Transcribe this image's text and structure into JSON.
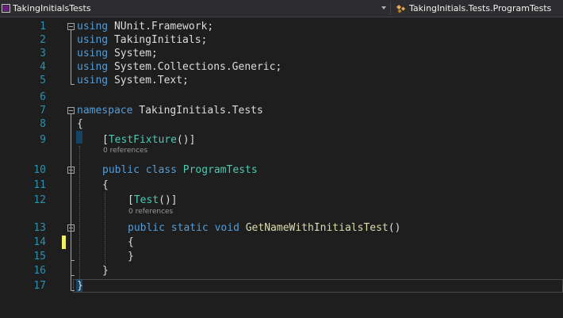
{
  "navbar": {
    "project": "TakingInitialsTests",
    "member": "TakingInitials.Tests.ProgramTests"
  },
  "editor": {
    "line_numbers": [
      "1",
      "2",
      "3",
      "4",
      "5",
      "6",
      "7",
      "8",
      "9",
      "10",
      "11",
      "12",
      "13",
      "14",
      "15",
      "16",
      "17"
    ],
    "code": {
      "l1_kw": "using",
      "l1_ns": " NUnit.Framework;",
      "l2_kw": "using",
      "l2_ns": " TakingInitials;",
      "l3_kw": "using",
      "l3_ns": " System;",
      "l4_kw": "using",
      "l4_ns": " System.Collections.Generic;",
      "l5_kw": "using",
      "l5_ns": " System.Text;",
      "l7_kw": "namespace",
      "l7_ns": " TakingInitials.Tests",
      "l8": "{",
      "l9_open": "[",
      "l9_attr": "TestFixture",
      "l9_close": "()]",
      "l10_kw1": "public",
      "l10_kw2": "class",
      "l10_type": "ProgramTests",
      "l11": "{",
      "l12_open": "[",
      "l12_attr": "Test",
      "l12_close": "()]",
      "l13_kw1": "public",
      "l13_kw2": "static",
      "l13_kw3": "void",
      "l13_method": "GetNameWithInitialsTest",
      "l13_paren": "()",
      "l14": "{",
      "l15": "}",
      "l16": "}",
      "l17": "}"
    },
    "codelens": [
      "0 references",
      "0 references"
    ]
  },
  "colors": {
    "keyword": "#569cd6",
    "type": "#4ec9b0",
    "method": "#dcdcaa",
    "line_number": "#2b91af",
    "change_marker": "#efef6a"
  }
}
